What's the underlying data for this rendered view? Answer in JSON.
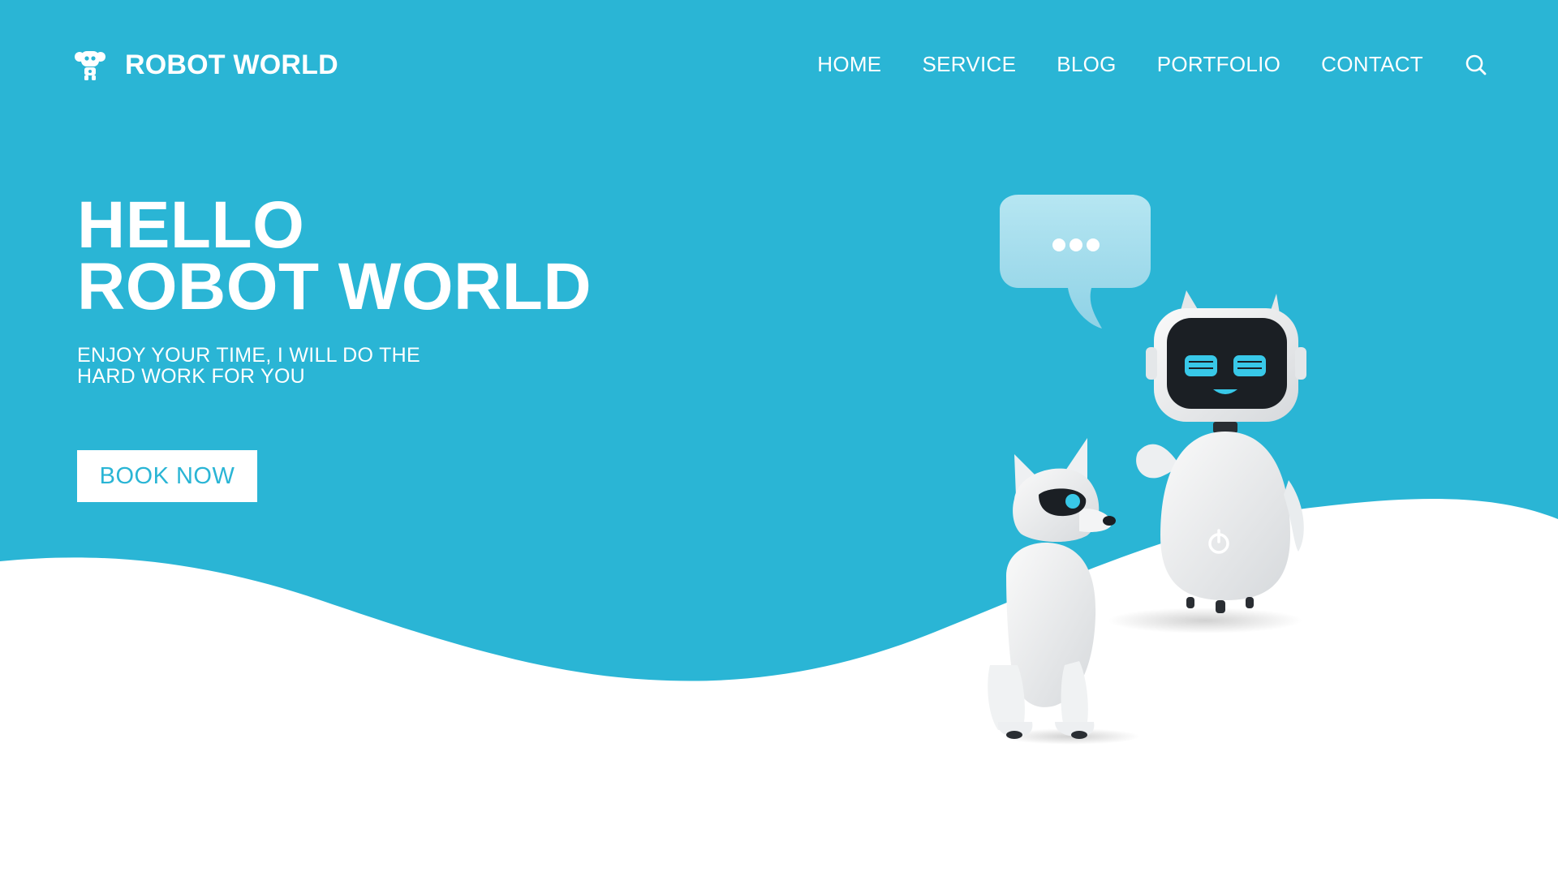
{
  "colors": {
    "brand_blue": "#2AB5D5",
    "white": "#FFFFFF",
    "bubble": "#A5DCEB"
  },
  "header": {
    "logo_icon": "robot-head-icon",
    "brand_name": "ROBOT WORLD",
    "nav": [
      "HOME",
      "SERVICE",
      "BLOG",
      "PORTFOLIO",
      "CONTACT"
    ],
    "search_icon": "search-icon"
  },
  "hero": {
    "title_line1": "HELLO",
    "title_line2": "ROBOT WORLD",
    "subtitle_line1": "ENJOY YOUR TIME, I WILL DO THE",
    "subtitle_line2": "HARD WORK FOR YOU",
    "cta_label": "BOOK NOW"
  },
  "illustration": {
    "speech_bubble_icon": "speech-bubble-icon",
    "robot": "robot-icon",
    "robot_dog": "robot-dog-icon"
  }
}
